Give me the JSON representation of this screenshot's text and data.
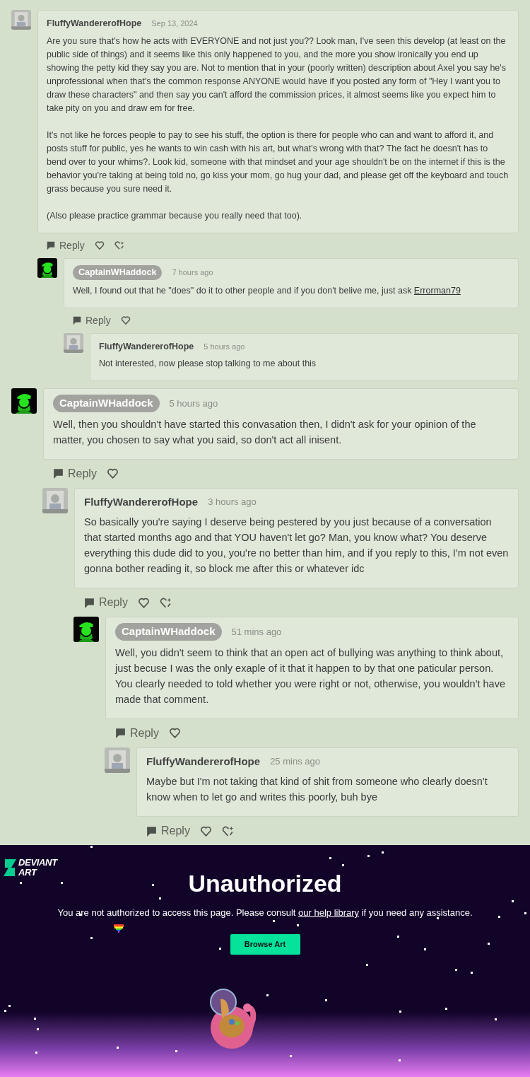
{
  "threads": [
    {
      "author": "FluffyWandererofHope",
      "highlighted": false,
      "avatar": {
        "kind": "photo"
      },
      "time": "Sep 13, 2024",
      "body": [
        [
          {
            "text": "Are you sure that's how he acts with EVERYONE and not just you?? Look man, I've seen this develop (at least on the public side of things) and it seems like this only happened to you, and the more you show ironically you end up showing the petty kid they say you are. Not to mention that in your (poorly written) description about Axel you say he's unprofessional when that's the common response ANYONE would have if you posted any form of \"Hey I want you to draw these characters\" and then say you can't afford the commission prices, it almost seems like you expect him to take pity on you and draw em for free."
          }
        ],
        [
          {
            "text": "It's not like he forces people to pay to see his stuff, the option is there for people who can and want to afford it, and posts stuff for public, yes he wants to win cash with his art, but what's wrong with that? The fact he doesn't has to bend over to your whims?. Look kid, someone with that mindset and your age shouldn't be on the internet if this is the behavior you're taking at being told no, go kiss your mom, go hug your dad, and please get off the keyboard and touch grass because you sure need it."
          }
        ],
        [
          {
            "text": "(Also please practice grammar because you really need that too)."
          }
        ]
      ],
      "reply": "Reply",
      "award": true,
      "children": [
        {
          "author": "CaptainWHaddock",
          "highlighted": true,
          "avatar": {
            "kind": "icon"
          },
          "time": "7 hours ago",
          "body": [
            [
              {
                "text": "Well, I found out that he \"does\" do it to other people and if you don't belive me, just ask "
              },
              {
                "kind": "link",
                "text": "Errorman79"
              }
            ]
          ],
          "reply": "Reply",
          "award": false,
          "children": [
            {
              "author": "FluffyWandererofHope",
              "highlighted": false,
              "avatar": {
                "kind": "photo"
              },
              "time": "5 hours ago",
              "body": [
                [
                  {
                    "text": "Not interested, now please stop talking to me about this"
                  }
                ]
              ]
            }
          ]
        }
      ]
    },
    {
      "author": "CaptainWHaddock",
      "highlighted": true,
      "avatar": {
        "kind": "icon"
      },
      "time": "5 hours ago",
      "body": [
        [
          {
            "text": "Well, then you shouldn't have started this convasation then, I didn't ask for your opinion of the matter, you chosen to say what you said, so don't act all inisent."
          }
        ]
      ],
      "reply": "Reply",
      "award": false,
      "children": [
        {
          "author": "FluffyWandererofHope",
          "highlighted": false,
          "avatar": {
            "kind": "photo"
          },
          "time": "3 hours ago",
          "body": [
            [
              {
                "text": "So basically you're saying I deserve being pestered by you just because of a conversation that started months ago and that YOU haven't let go? Man, you know what? You deserve everything this dude did to you, you're no better than him, and if you reply to this, I'm not even gonna bother reading it, so block me after this or whatever idc"
              }
            ]
          ],
          "reply": "Reply",
          "award": true,
          "children": [
            {
              "author": "CaptainWHaddock",
              "highlighted": true,
              "avatar": {
                "kind": "icon"
              },
              "time": "51 mins ago",
              "body": [
                [
                  {
                    "text": "Well, you didn't seem to think that an open act of bullying was anything to think about, just becuse I was the only exaple of it that it happen to by that one paticular person. You clearly needed to told whether you were right or not, otherwise, you wouldn't have made that comment."
                  }
                ]
              ],
              "reply": "Reply",
              "award": false,
              "children": [
                {
                  "author": "FluffyWandererofHope",
                  "highlighted": false,
                  "avatar": {
                    "kind": "photo"
                  },
                  "time": "25 mins ago",
                  "body": [
                    [
                      {
                        "text": "Maybe but I'm not taking that kind of shit from someone who clearly doesn't know when to let go and writes this poorly, buh bye"
                      }
                    ]
                  ],
                  "reply": "Reply",
                  "award": true
                }
              ]
            }
          ]
        }
      ]
    }
  ],
  "error_page": {
    "logo_lines": [
      "DEVIANT",
      "ART"
    ],
    "title": "Unauthorized",
    "message": [
      {
        "text": "You are not authorized to access this page. Please consult "
      },
      {
        "kind": "link",
        "text": "our help library"
      },
      {
        "text": " if you need any assistance."
      }
    ],
    "button": "Browse Art"
  }
}
